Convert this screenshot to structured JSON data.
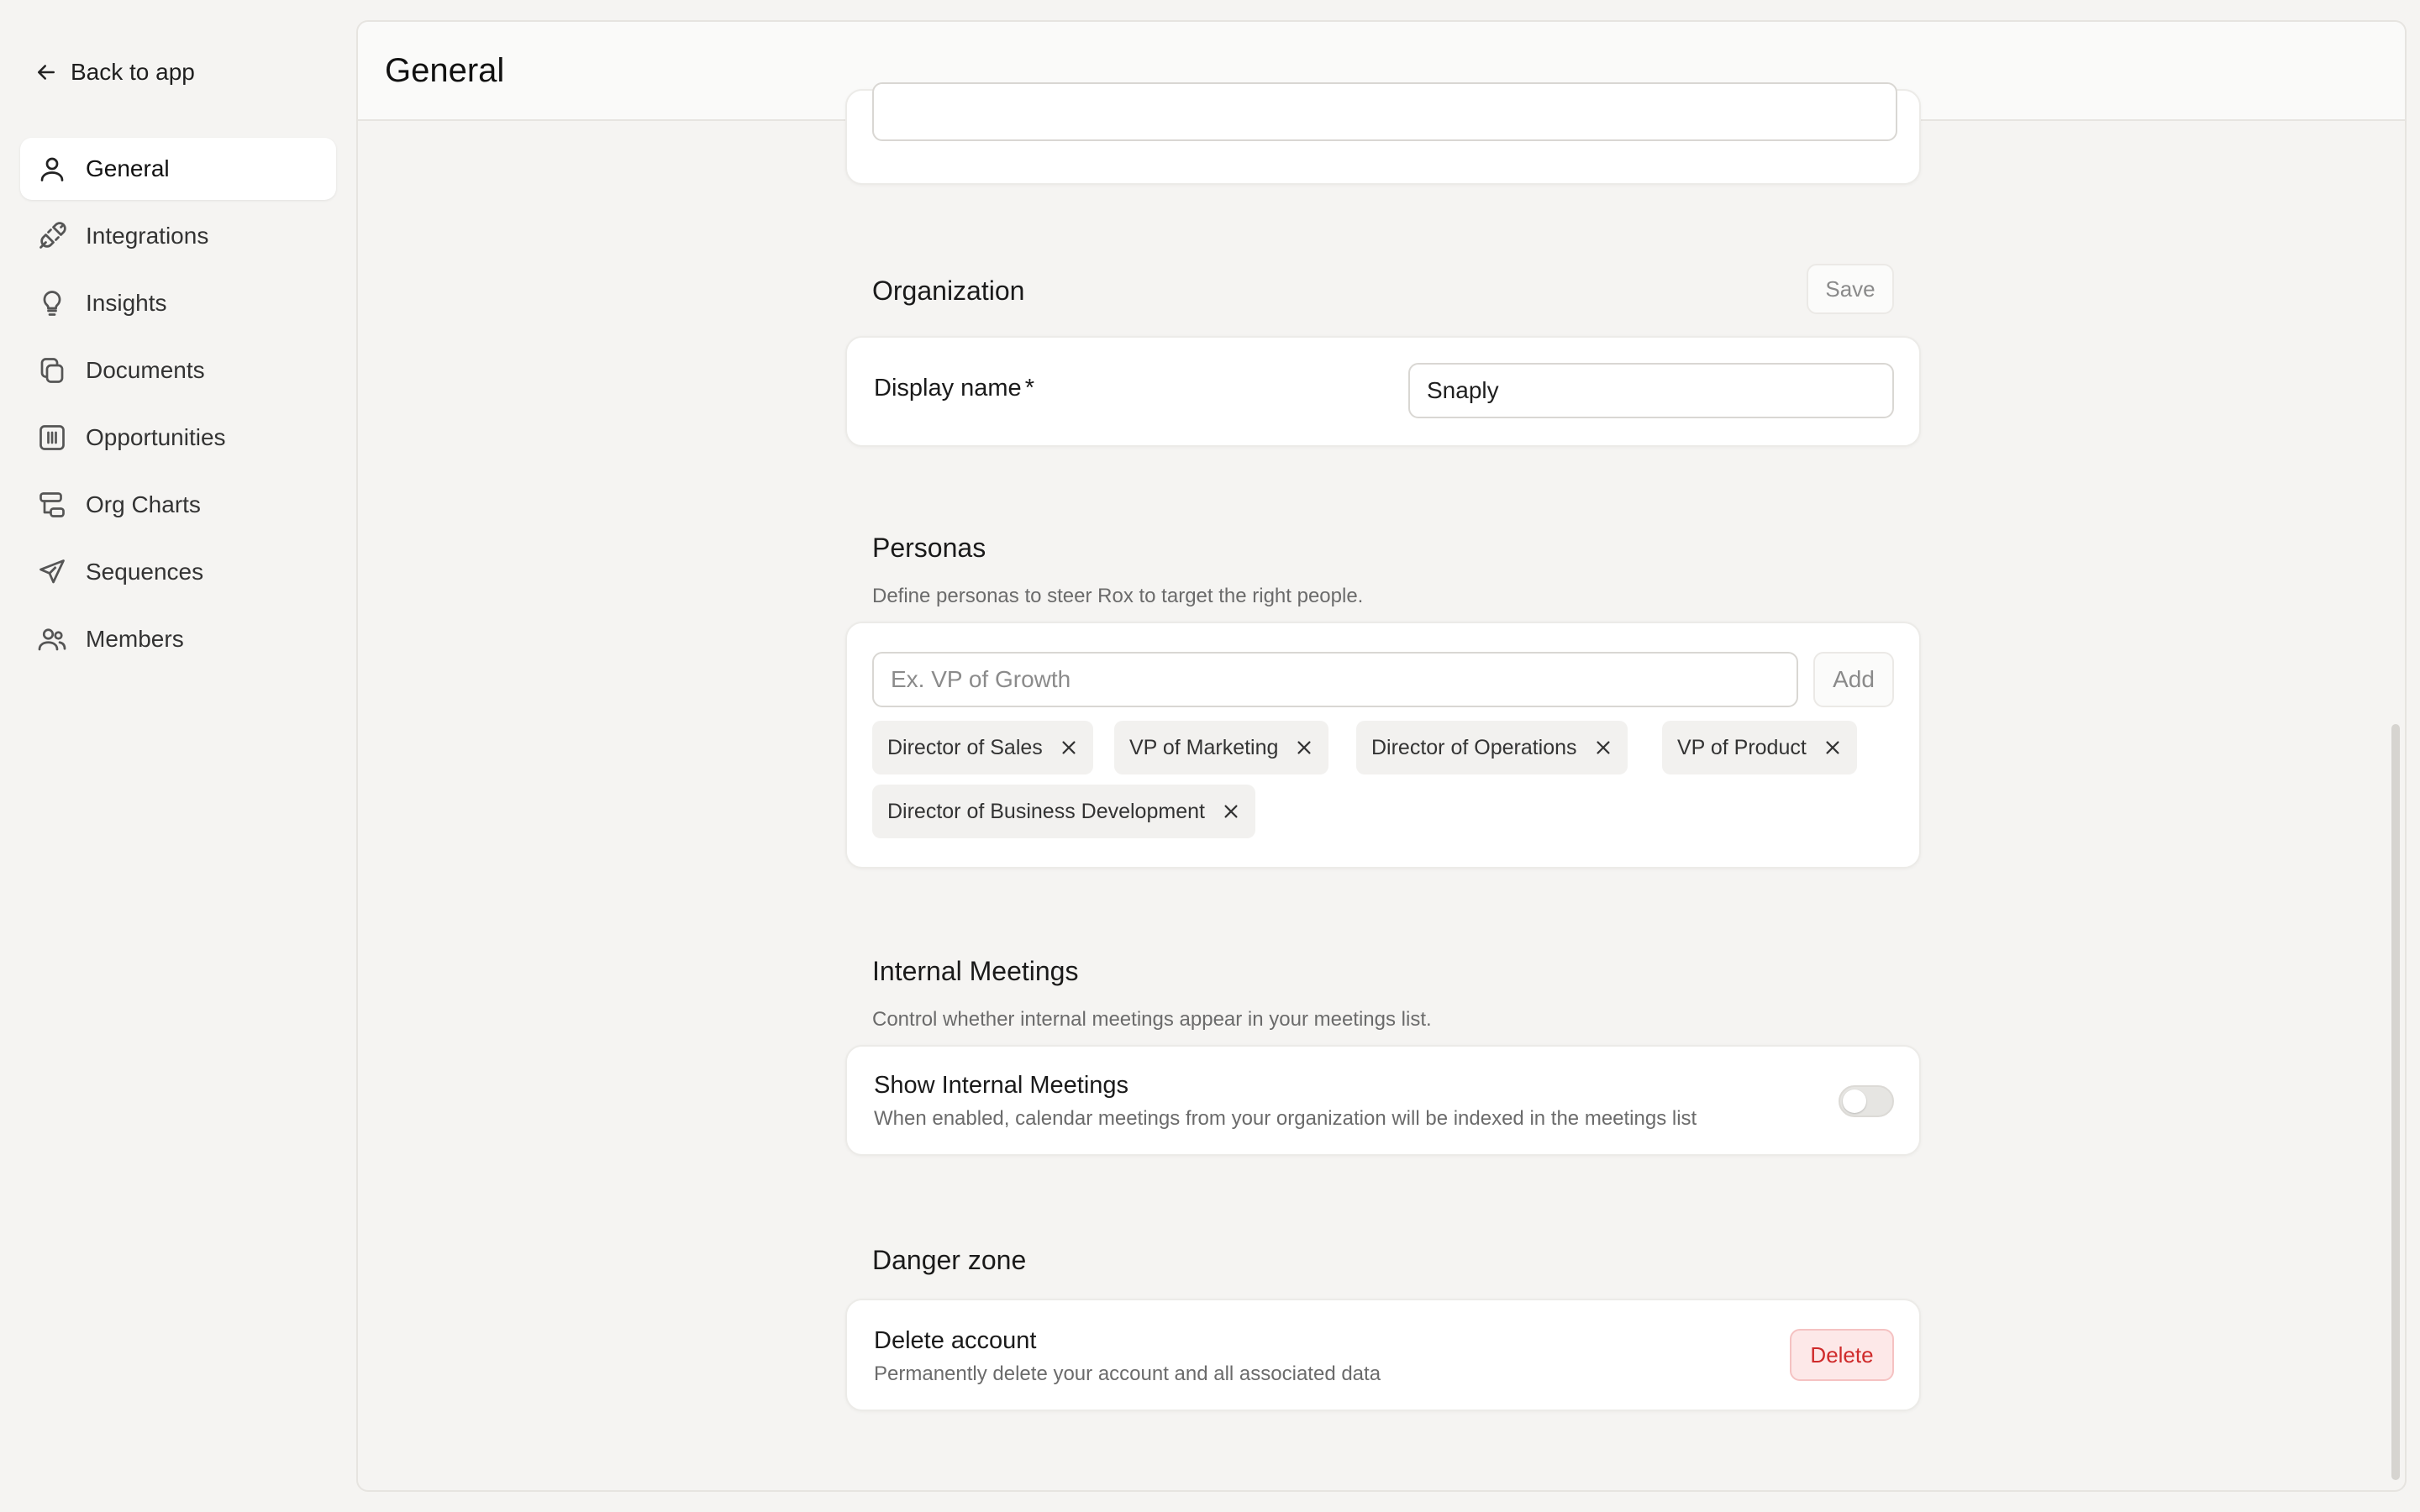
{
  "sidebar": {
    "back_label": "Back to app",
    "items": [
      {
        "label": "General",
        "icon": "person-icon"
      },
      {
        "label": "Integrations",
        "icon": "plug-icon"
      },
      {
        "label": "Insights",
        "icon": "lightbulb-icon"
      },
      {
        "label": "Documents",
        "icon": "documents-icon"
      },
      {
        "label": "Opportunities",
        "icon": "columns-icon"
      },
      {
        "label": "Org Charts",
        "icon": "org-chart-icon"
      },
      {
        "label": "Sequences",
        "icon": "send-icon"
      },
      {
        "label": "Members",
        "icon": "members-icon"
      }
    ]
  },
  "header": {
    "title": "General"
  },
  "organization": {
    "title": "Organization",
    "save_label": "Save",
    "display_name_label": "Display name",
    "required_mark": "*",
    "display_name_value": "Snaply"
  },
  "personas": {
    "title": "Personas",
    "description": "Define personas to steer Rox to target the right people.",
    "input_placeholder": "Ex. VP of Growth",
    "add_label": "Add",
    "chips": [
      "Director of Sales",
      "VP of Marketing",
      "Director of Operations",
      "VP of Product",
      "Director of Business Development"
    ]
  },
  "internal_meetings": {
    "title": "Internal Meetings",
    "description": "Control whether internal meetings appear in your meetings list.",
    "row_title": "Show Internal Meetings",
    "row_sub": "When enabled, calendar meetings from your organization will be indexed in the meetings list",
    "enabled": false
  },
  "danger": {
    "title": "Danger zone",
    "row_title": "Delete account",
    "row_sub": "Permanently delete your account and all associated data",
    "delete_label": "Delete"
  },
  "colors": {
    "danger": "#cf2a2a",
    "background": "#f5f4f2"
  }
}
